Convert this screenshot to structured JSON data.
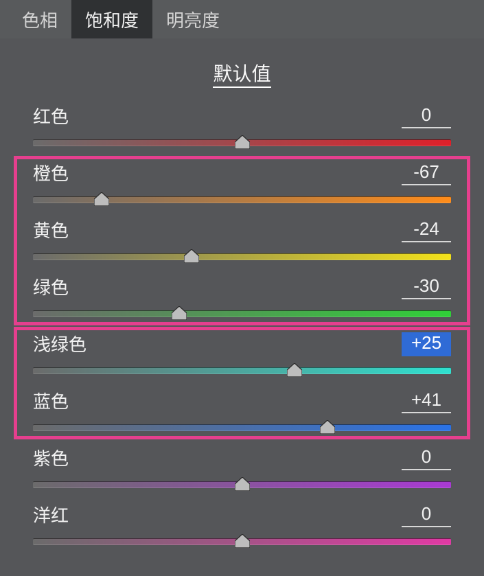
{
  "tabs": {
    "hue": "色相",
    "saturation": "饱和度",
    "luminance": "明亮度",
    "active": "saturation"
  },
  "defaults_label": "默认值",
  "sliders": [
    {
      "key": "red",
      "label": "红色",
      "value": "0",
      "value_num": 0,
      "grad_from": "#6b6b6b",
      "grad_to": "#e0202a"
    },
    {
      "key": "orange",
      "label": "橙色",
      "value": "-67",
      "value_num": -67,
      "grad_from": "#6b6b6b",
      "grad_to": "#ff8c1a"
    },
    {
      "key": "yellow",
      "label": "黄色",
      "value": "-24",
      "value_num": -24,
      "grad_from": "#6b6b6b",
      "grad_to": "#f2e11a"
    },
    {
      "key": "green",
      "label": "绿色",
      "value": "-30",
      "value_num": -30,
      "grad_from": "#6b6b6b",
      "grad_to": "#30d038"
    },
    {
      "key": "aqua",
      "label": "浅绿色",
      "value": "+25",
      "value_num": 25,
      "grad_from": "#6b6b6b",
      "grad_to": "#2fe0cf",
      "value_selected": true
    },
    {
      "key": "blue",
      "label": "蓝色",
      "value": "+41",
      "value_num": 41,
      "grad_from": "#6b6b6b",
      "grad_to": "#2a72e6"
    },
    {
      "key": "purple",
      "label": "紫色",
      "value": "0",
      "value_num": 0,
      "grad_from": "#6b6b6b",
      "grad_to": "#a93ad4"
    },
    {
      "key": "magenta",
      "label": "洋红",
      "value": "0",
      "value_num": 0,
      "grad_from": "#6b6b6b",
      "grad_to": "#e03aa4"
    }
  ],
  "slider_range": {
    "min": -100,
    "max": 100
  },
  "highlights": [
    {
      "slider_keys": [
        "orange",
        "yellow",
        "green"
      ]
    },
    {
      "slider_keys": [
        "aqua",
        "blue"
      ]
    }
  ]
}
